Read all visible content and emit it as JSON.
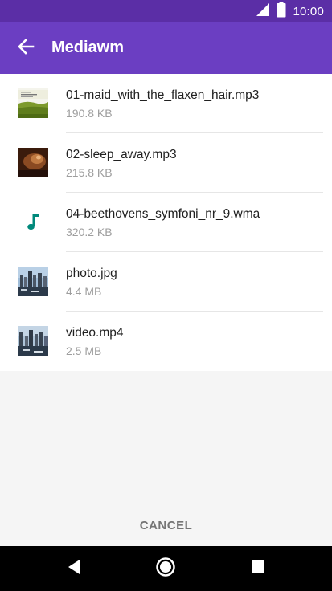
{
  "status_bar": {
    "time": "10:00",
    "icons": [
      "signal-icon",
      "battery-icon"
    ]
  },
  "app_bar": {
    "title": "Mediawm",
    "back_icon": "arrow-back-icon"
  },
  "files": [
    {
      "name": "01-maid_with_the_flaxen_hair.mp3",
      "size": "190.8 KB",
      "thumb": "album-art-green"
    },
    {
      "name": "02-sleep_away.mp3",
      "size": "215.8 KB",
      "thumb": "album-art-brown"
    },
    {
      "name": "04-beethovens_symfoni_nr_9.wma",
      "size": "320.2 KB",
      "thumb": "music-note-icon"
    },
    {
      "name": "photo.jpg",
      "size": "4.4 MB",
      "thumb": "photo-thumbnail"
    },
    {
      "name": "video.mp4",
      "size": "2.5 MB",
      "thumb": "video-thumbnail"
    }
  ],
  "cancel_label": "CANCEL",
  "colors": {
    "status_bar": "#5b2ea6",
    "app_bar": "#6b3ec2",
    "music_note": "#00897b"
  },
  "nav": [
    "back-icon",
    "home-icon",
    "recents-icon"
  ]
}
